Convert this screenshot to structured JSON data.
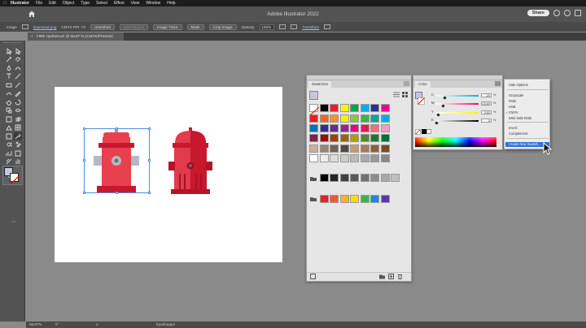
{
  "os_menubar": {
    "app_name": "Illustrator",
    "items": [
      "File",
      "Edit",
      "Object",
      "Type",
      "Select",
      "Effect",
      "View",
      "Window",
      "Help"
    ]
  },
  "appbar": {
    "title": "Adobe Illustrator 2022",
    "share_label": "Share"
  },
  "controlbar": {
    "image_label": "Image",
    "file_link": "download.png",
    "color_info": "CMYK   PPI: 72",
    "embed": "Unembed",
    "edit_original": "Edit Original",
    "image_trace": "Image Trace",
    "mask": "Mask",
    "crop_image": "Crop Image",
    "opacity_label": "Opacity:",
    "opacity_value": "100%",
    "transform": "Transform"
  },
  "document_tab": {
    "label": "FIRE Hydrant.ai* @ 66.67 % (CMYK/Preview)"
  },
  "statusbar": {
    "zoom": "66.67%",
    "rotation": "0°",
    "artboard_nav": "1",
    "tool": "Eyedropper"
  },
  "swatches_panel": {
    "tab": "Swatches",
    "rows": [
      [
        "#ffffff",
        "#000000",
        "#ee1c25",
        "#fff200",
        "#00a651",
        "#00aeef",
        "#2e3192",
        "#ec008c"
      ],
      [
        "#ed1c24",
        "#f26522",
        "#f7941d",
        "#fff200",
        "#8dc63f",
        "#39b54a",
        "#00a99d",
        "#00aeef"
      ],
      [
        "#0072bc",
        "#2e3192",
        "#662d91",
        "#92278f",
        "#ec008c",
        "#ed145b",
        "#f26d7d",
        "#f49ac1"
      ],
      [
        "#7d2248",
        "#9e0b0f",
        "#a0410d",
        "#a36209",
        "#aba000",
        "#598527",
        "#1a7b30",
        "#007236"
      ],
      [
        "#c7b299",
        "#998675",
        "#736357",
        "#534741",
        "#c69c6d",
        "#a67c52",
        "#8c6239",
        "#754c24"
      ],
      [
        "#ffffff",
        "#eeeeee",
        "#dddddd",
        "#cccccc",
        "#bbbbbb",
        "#aaaaaa",
        "#999999",
        "#888888"
      ],
      [
        "#000000",
        "#262626",
        "#404040",
        "#595959",
        "#737373",
        "#8c8c8c",
        "#a6a6a6",
        "#bfbfbf"
      ],
      [
        "#e3212b",
        "#f05a28",
        "#fbb034",
        "#ffdd00",
        "#39b54a",
        "#1e88e5",
        "#5e35b1"
      ]
    ]
  },
  "color_panel": {
    "tab": "Color",
    "channels": [
      {
        "name": "C",
        "value": "20",
        "unit": "%",
        "fraction": 0.2
      },
      {
        "name": "M",
        "value": "15.69",
        "unit": "%",
        "fraction": 0.157
      },
      {
        "name": "Y",
        "value": "3.53",
        "unit": "%",
        "fraction": 0.035
      },
      {
        "name": "K",
        "value": "0",
        "unit": "%",
        "fraction": 0.0
      }
    ],
    "fill_color": "#c5c8dd"
  },
  "flyout_menu": {
    "items": [
      {
        "label": "Hide Options"
      },
      {
        "label": "Grayscale"
      },
      {
        "label": "RGB"
      },
      {
        "label": "HSB"
      },
      {
        "label": "CMYK",
        "checked": true
      },
      {
        "label": "Web Safe RGB"
      },
      {
        "label": "Invert"
      },
      {
        "label": "Complement"
      },
      {
        "label": "Create New Swatch...",
        "highlighted": true
      }
    ]
  },
  "colors": {
    "hydrant_light": "#e8404f",
    "hydrant_dark": "#c8182d",
    "selection_blue": "#4f8ee8",
    "menu_highlight": "#2f6fd6"
  }
}
